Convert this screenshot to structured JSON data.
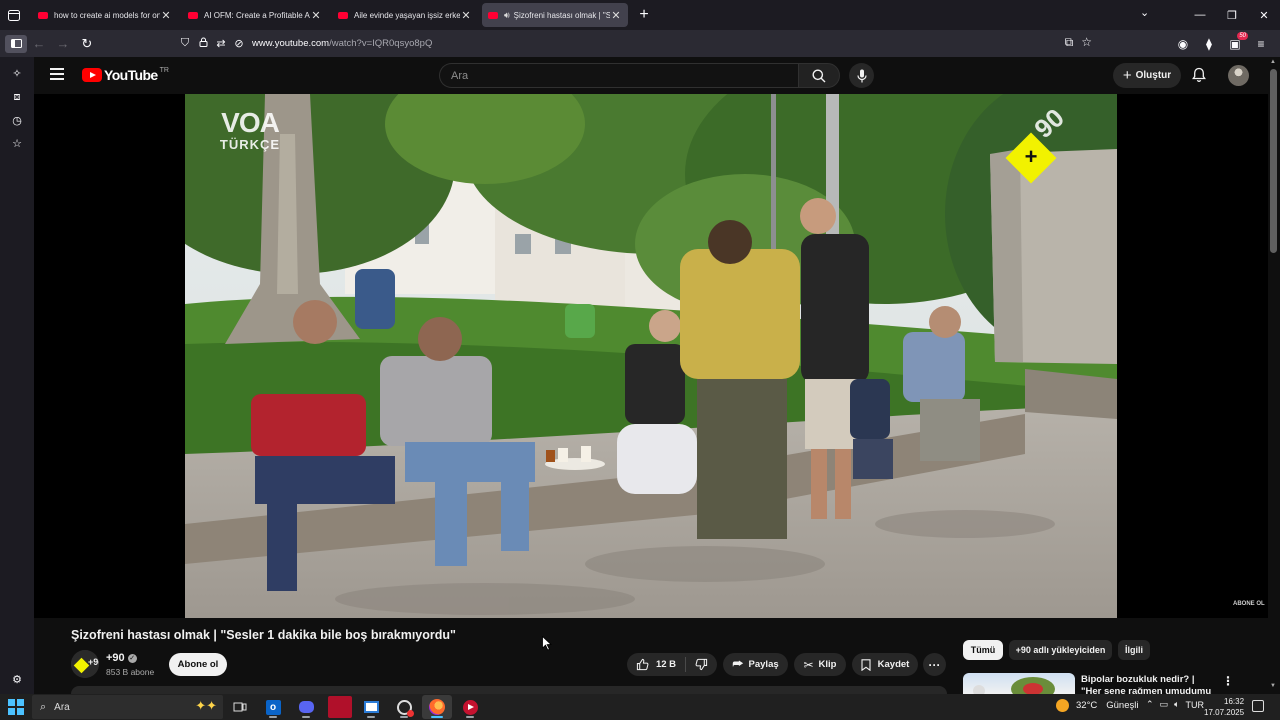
{
  "browser": {
    "tabs": [
      {
        "label": "how to create ai models for onl",
        "active": false
      },
      {
        "label": "AI OFM: Create a Profitable AI I",
        "active": false
      },
      {
        "label": "Aile evinde yaşayan işsiz erkek",
        "active": false
      },
      {
        "label": "Şizofreni hastası olmak | \"Se",
        "active": true
      }
    ],
    "url_host": "www.youtube.com",
    "url_path": "/watch?v=IQR0qsyo8pQ",
    "extension_badge": "50"
  },
  "youtube": {
    "logo_text": "YouTube",
    "country_code": "TR",
    "search_placeholder": "Ara",
    "create_label": "Oluştur"
  },
  "video": {
    "watermark_top": "VOA",
    "watermark_sub": "TÜRKÇE",
    "channel_badge": "+90",
    "bottom_watermark": "ABONE OL",
    "title": "Şizofreni hastası olmak | \"Sesler 1 dakika bile boş bırakmıyordu\""
  },
  "channel": {
    "name": "+90",
    "avatar_text": "+90",
    "subscribers": "853 B abone",
    "subscribe_label": "Abone ol"
  },
  "actions": {
    "likes": "12 B",
    "share_label": "Paylaş",
    "clip_label": "Klip",
    "save_label": "Kaydet"
  },
  "related": {
    "chips": [
      {
        "label": "Tümü",
        "selected": true
      },
      {
        "label": "+90 adlı yükleyiciden",
        "selected": false
      },
      {
        "label": "İlgili",
        "selected": false
      }
    ],
    "first_title": "Bipolar bozukluk nedir? | \"Her sene rağmen umudumu bir"
  },
  "taskbar": {
    "search_placeholder": "Ara",
    "temperature": "32°C",
    "weather_desc": "Güneşli",
    "language": "TUR",
    "time": "16:32",
    "date": "17.07.2025"
  },
  "colors": {
    "youtube_red": "#ff0000",
    "page_bg": "#0f0f0f",
    "firefox_tabbar": "#1c1b22",
    "badge_yellow": "#f2f200"
  }
}
